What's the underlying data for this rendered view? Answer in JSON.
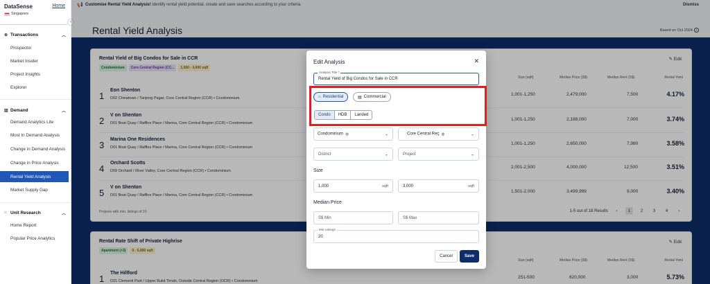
{
  "sidebar": {
    "brand": "DataSense",
    "home_label": "Home",
    "country": "Singapore",
    "collapse_icon": "‹",
    "sections": [
      {
        "label": "Transactions",
        "items": [
          "Prospector",
          "Market Insider",
          "Project Insights",
          "Explorer"
        ]
      },
      {
        "label": "Demand",
        "items": [
          "Demand Analytics Lite",
          "Most In Demand Analysis",
          "Change in Demand Analysis",
          "Change in Price Analysis",
          "Rental Yield Analysis",
          "Market Supply Gap"
        ]
      },
      {
        "label": "Unit Research",
        "items": [
          "Home Report",
          "Popular Price Analytics"
        ]
      }
    ],
    "active_item": "Rental Yield Analysis"
  },
  "banner": {
    "title": "Customise Rental Yield Analysis!",
    "text": "Identify rental yield potential, create and save searches according to your criteria.",
    "dismiss": "Dismiss"
  },
  "page": {
    "title": "Rental Yield Analysis",
    "based_on": "Based on Oct 2024"
  },
  "card1": {
    "title": "Rental Yield of Big Condos for Sale in CCR",
    "edit": "Edit",
    "tags": [
      "Condominium",
      "Core Central Region (CC...",
      "1,000 - 3,000 sqft"
    ],
    "columns": {
      "size": "Size (sqft)",
      "price": "Median Price (S$)",
      "rent": "Median Rent (S$)",
      "yield": "Rental Yield"
    },
    "rows": [
      {
        "rank": "1",
        "name": "Eon Shenton",
        "addr": "D02 Chinatown / Tanjong Pagar, Core Central Region (CCR) • Condominium",
        "size": "1,001-1,250",
        "price": "2,479,000",
        "rent": "7,500",
        "yield": "4.17%"
      },
      {
        "rank": "2",
        "name": "V on Shenton",
        "addr": "D01 Boat Quay / Raffles Place / Marina, Core Central Region (CCR) • Condominium",
        "size": "1,001-1,250",
        "price": "2,188,000",
        "rent": "7,000",
        "yield": "3.74%"
      },
      {
        "rank": "3",
        "name": "Marina One Residences",
        "addr": "D01 Boat Quay / Raffles Place / Marina, Core Central Region (CCR) • Condominium",
        "size": "1,001-1,250",
        "price": "2,650,000",
        "rent": "7,980",
        "yield": "3.58%"
      },
      {
        "rank": "4",
        "name": "Orchard Scotts",
        "addr": "D09 Orchard / River Valley, Core Central Region (CCR) • Condominium",
        "size": "2,001-2,500",
        "price": "4,000,000",
        "rent": "12,500",
        "yield": "3.51%"
      },
      {
        "rank": "5",
        "name": "V on Shenton",
        "addr": "D01 Boat Quay / Raffles Place / Marina, Core Central Region (CCR) • Condominium",
        "size": "1,501-2,000",
        "price": "3,499,999",
        "rent": "9,000",
        "yield": "3.40%"
      }
    ],
    "footer_note": "Projects with min. listings of 20",
    "pagination_text": "1-5 out of 18 Results",
    "pages": [
      "1",
      "2",
      "3",
      "4"
    ]
  },
  "card2": {
    "title": "Rental Rate Shift of Private Highrise",
    "edit": "Edit",
    "tags": [
      "Apartment (+3)",
      "0 - 5,000 sqft"
    ],
    "row": {
      "rank": "1",
      "name": "The Hillford",
      "addr": "D21 Clementi Park / Upper Bukit Timah, Outside Central Region (OCR) • Condominium",
      "size": "251-500",
      "price": "620,000",
      "rent": "3,000",
      "yield": "5.73%"
    }
  },
  "modal": {
    "title": "Edit Analysis",
    "analysis_title_label": "Analysis Title *",
    "analysis_title_value": "Rental Yield of Big Condos for Sale in CCR",
    "category_residential": "Residential",
    "category_commercial": "Commercial",
    "types": [
      "Condo",
      "HDB",
      "Landed"
    ],
    "active_type": "Condo",
    "property_chip": "Condominium",
    "region_chip": "Core Central Reç",
    "district_placeholder": "District",
    "project_placeholder": "Project",
    "size_label": "Size",
    "size_min": "1,000",
    "size_max": "3,000",
    "size_unit": "sqft",
    "price_label": "Median Price",
    "price_min_placeholder": "S$ Min",
    "price_max_placeholder": "S$ Max",
    "min_listings_label": "Min Listings",
    "min_listings_value": "20",
    "cancel": "Cancel",
    "save": "Save"
  },
  "colors": {
    "accent": "#1f56b8",
    "navy": "#0f2d6b",
    "highlight_box": "#e11d22"
  }
}
